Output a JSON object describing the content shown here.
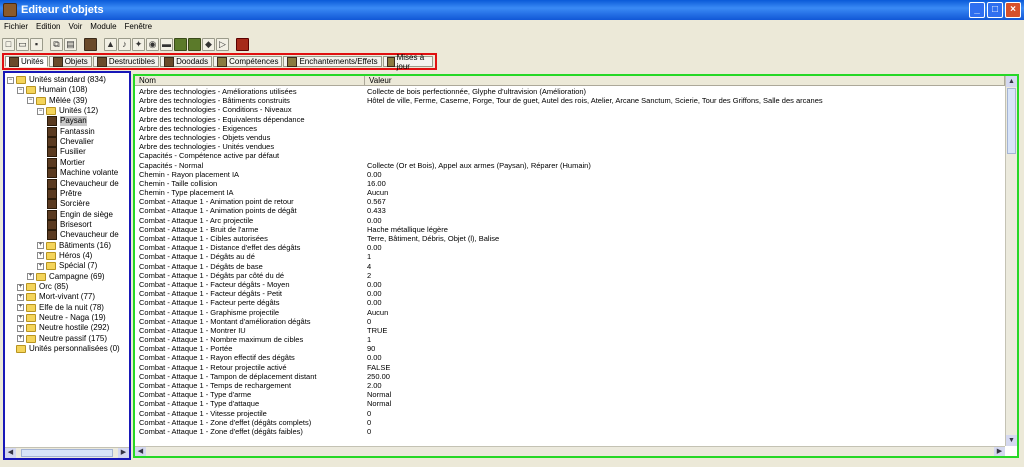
{
  "window": {
    "title": "Editeur d'objets"
  },
  "menu": [
    "Fichier",
    "Edition",
    "Voir",
    "Module",
    "Fenêtre"
  ],
  "tabs": [
    "Unités",
    "Objets",
    "Destructibles",
    "Doodads",
    "Compétences",
    "Enchantements/Effets",
    "Mises à jour"
  ],
  "tree": {
    "items": [
      {
        "label": "Unités standard (834)",
        "level": 0,
        "expander": "-",
        "icon": "folder"
      },
      {
        "label": "Humain (108)",
        "level": 1,
        "expander": "-",
        "icon": "folder"
      },
      {
        "label": "Mêlée (39)",
        "level": 2,
        "expander": "-",
        "icon": "folder"
      },
      {
        "label": "Unités (12)",
        "level": 3,
        "expander": "-",
        "icon": "folder"
      },
      {
        "label": "Paysan",
        "level": 4,
        "expander": "",
        "icon": "unit",
        "selected": true
      },
      {
        "label": "Fantassin",
        "level": 4,
        "expander": "",
        "icon": "unit"
      },
      {
        "label": "Chevalier",
        "level": 4,
        "expander": "",
        "icon": "unit"
      },
      {
        "label": "Fusilier",
        "level": 4,
        "expander": "",
        "icon": "unit"
      },
      {
        "label": "Mortier",
        "level": 4,
        "expander": "",
        "icon": "unit"
      },
      {
        "label": "Machine volante",
        "level": 4,
        "expander": "",
        "icon": "unit"
      },
      {
        "label": "Chevaucheur de",
        "level": 4,
        "expander": "",
        "icon": "unit"
      },
      {
        "label": "Prêtre",
        "level": 4,
        "expander": "",
        "icon": "unit"
      },
      {
        "label": "Sorcière",
        "level": 4,
        "expander": "",
        "icon": "unit"
      },
      {
        "label": "Engin de siège",
        "level": 4,
        "expander": "",
        "icon": "unit"
      },
      {
        "label": "Brisesort",
        "level": 4,
        "expander": "",
        "icon": "unit"
      },
      {
        "label": "Chevaucheur de",
        "level": 4,
        "expander": "",
        "icon": "unit"
      },
      {
        "label": "Bâtiments (16)",
        "level": 3,
        "expander": "+",
        "icon": "folder"
      },
      {
        "label": "Héros (4)",
        "level": 3,
        "expander": "+",
        "icon": "folder"
      },
      {
        "label": "Spécial (7)",
        "level": 3,
        "expander": "+",
        "icon": "folder"
      },
      {
        "label": "Campagne (69)",
        "level": 2,
        "expander": "+",
        "icon": "folder"
      },
      {
        "label": "Orc (85)",
        "level": 1,
        "expander": "+",
        "icon": "folder"
      },
      {
        "label": "Mort-vivant (77)",
        "level": 1,
        "expander": "+",
        "icon": "folder"
      },
      {
        "label": "Elfe de la nuit (78)",
        "level": 1,
        "expander": "+",
        "icon": "folder"
      },
      {
        "label": "Neutre - Naga (19)",
        "level": 1,
        "expander": "+",
        "icon": "folder"
      },
      {
        "label": "Neutre hostile (292)",
        "level": 1,
        "expander": "+",
        "icon": "folder"
      },
      {
        "label": "Neutre passif (175)",
        "level": 1,
        "expander": "+",
        "icon": "folder"
      },
      {
        "label": "Unités personnalisées (0)",
        "level": 0,
        "expander": "",
        "icon": "folder"
      }
    ]
  },
  "grid": {
    "headers": {
      "name": "Nom",
      "value": "Valeur"
    },
    "rows": [
      [
        "Arbre des technologies - Améliorations utilisées",
        "Collecte de bois perfectionnée, Glyphe d'ultravision (Amélioration)"
      ],
      [
        "Arbre des technologies - Bâtiments construits",
        "Hôtel de ville, Ferme, Caserne, Forge, Tour de guet, Autel des rois, Atelier, Arcane Sanctum, Scierie, Tour des Griffons, Salle des arcanes"
      ],
      [
        "Arbre des technologies - Conditions - Niveaux",
        ""
      ],
      [
        "Arbre des technologies - Equivalents dépendance",
        ""
      ],
      [
        "Arbre des technologies - Exigences",
        ""
      ],
      [
        "Arbre des technologies - Objets vendus",
        ""
      ],
      [
        "Arbre des technologies - Unités vendues",
        ""
      ],
      [
        "Capacités - Compétence active par défaut",
        ""
      ],
      [
        "Capacités - Normal",
        "Collecte (Or et Bois), Appel aux armes (Paysan), Réparer (Humain)"
      ],
      [
        "Chemin - Rayon placement IA",
        "0.00"
      ],
      [
        "Chemin - Taille collision",
        "16.00"
      ],
      [
        "Chemin - Type placement IA",
        "Aucun"
      ],
      [
        "Combat - Attaque 1 - Animation point de retour",
        "0.567"
      ],
      [
        "Combat - Attaque 1 - Animation points de dégât",
        "0.433"
      ],
      [
        "Combat - Attaque 1 - Arc projectile",
        "0.00"
      ],
      [
        "Combat - Attaque 1 - Bruit de l'arme",
        "Hache métallique légère"
      ],
      [
        "Combat - Attaque 1 - Cibles autorisées",
        "Terre, Bâtiment, Débris, Objet (l), Balise"
      ],
      [
        "Combat - Attaque 1 - Distance d'effet des dégâts",
        "0.00"
      ],
      [
        "Combat - Attaque 1 - Dégâts au dé",
        "1"
      ],
      [
        "Combat - Attaque 1 - Dégâts de base",
        "4"
      ],
      [
        "Combat - Attaque 1 - Dégâts par côté du dé",
        "2"
      ],
      [
        "Combat - Attaque 1 - Facteur dégâts - Moyen",
        "0.00"
      ],
      [
        "Combat - Attaque 1 - Facteur dégâts - Petit",
        "0.00"
      ],
      [
        "Combat - Attaque 1 - Facteur perte dégâts",
        "0.00"
      ],
      [
        "Combat - Attaque 1 - Graphisme projectile",
        "Aucun"
      ],
      [
        "Combat - Attaque 1 - Montant d'amélioration dégâts",
        "0"
      ],
      [
        "Combat - Attaque 1 - Montrer IU",
        "TRUE"
      ],
      [
        "Combat - Attaque 1 - Nombre maximum de cibles",
        "1"
      ],
      [
        "Combat - Attaque 1 - Portée",
        "90"
      ],
      [
        "Combat - Attaque 1 - Rayon effectif des dégâts",
        "0.00"
      ],
      [
        "Combat - Attaque 1 - Retour projectile activé",
        "FALSE"
      ],
      [
        "Combat - Attaque 1 - Tampon de déplacement distant",
        "250.00"
      ],
      [
        "Combat - Attaque 1 - Temps de rechargement",
        "2.00"
      ],
      [
        "Combat - Attaque 1 - Type d'arme",
        "Normal"
      ],
      [
        "Combat - Attaque 1 - Type d'attaque",
        "Normal"
      ],
      [
        "Combat - Attaque 1 - Vitesse projectile",
        "0"
      ],
      [
        "Combat - Attaque 1 - Zone d'effet (dégâts complets)",
        "0"
      ],
      [
        "Combat - Attaque 1 - Zone d'effet (dégâts faibles)",
        "0"
      ]
    ]
  }
}
